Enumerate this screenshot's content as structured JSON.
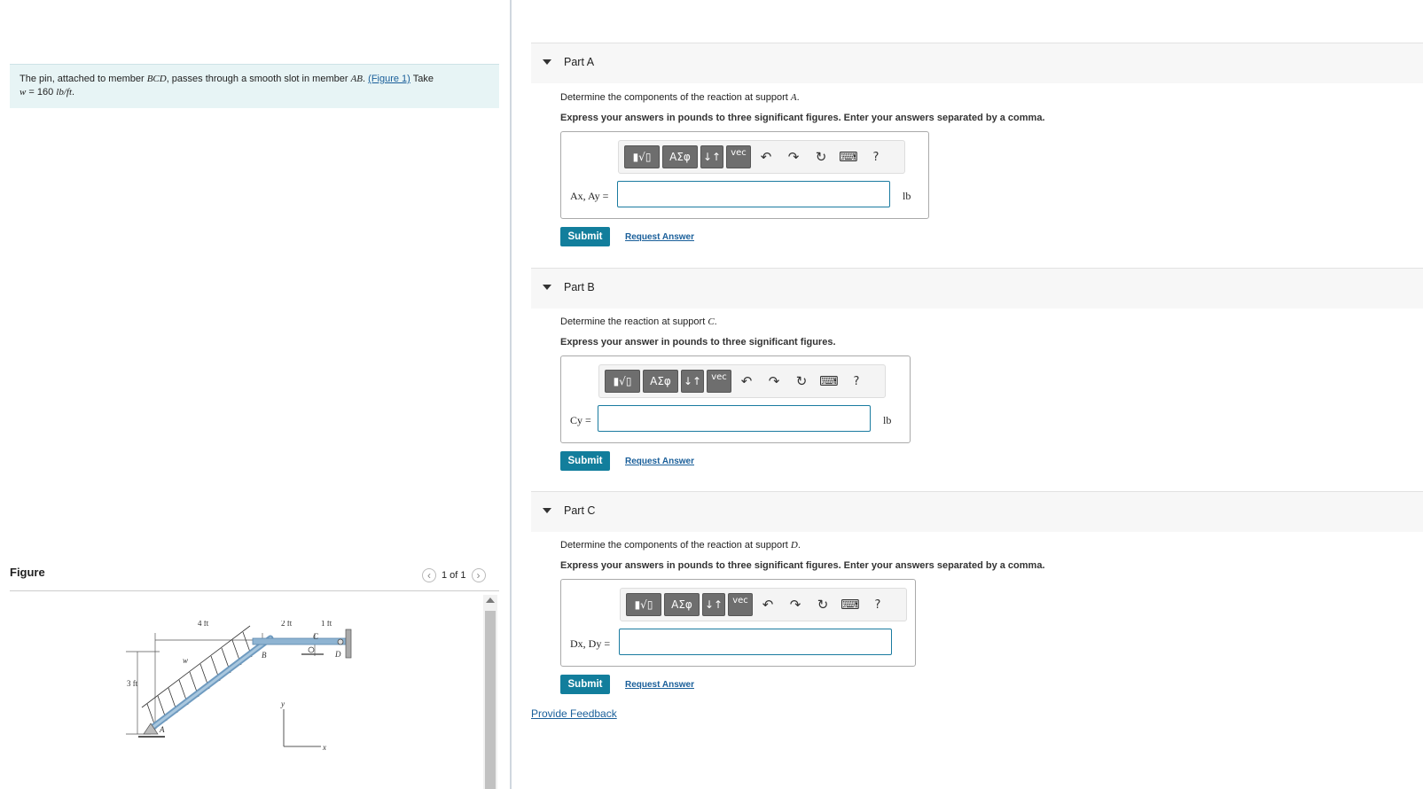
{
  "problem": {
    "text_before_bcd": "The pin, attached to member ",
    "bcd": "BCD",
    "text_mid": ", passes through a smooth slot in member ",
    "ab": "AB",
    "text_after_ab": ". ",
    "figure_link": "(Figure 1)",
    "take": " Take",
    "w_expr": "w",
    "w_value": " = 160 ",
    "w_units": "lb/ft",
    "period": "."
  },
  "figure": {
    "label": "Figure",
    "pager": "1 of 1",
    "labels": {
      "four_ft": "4 ft",
      "two_ft": "2 ft",
      "one_ft": "1 ft",
      "three_ft": "3 ft",
      "w": "w",
      "b": "B",
      "c": "C",
      "d": "D",
      "a": "A",
      "y": "y",
      "x": "x"
    }
  },
  "parts": [
    {
      "title": "Part A",
      "question_text": "Determine the components of the reaction at support ",
      "question_var": "A",
      "instruction": "Express your answers in pounds to three significant figures. Enter your answers separated by a comma.",
      "answer_label": "Ax, Ay =",
      "answer_value": "",
      "unit": "lb"
    },
    {
      "title": "Part B",
      "question_text": "Determine the reaction at support ",
      "question_var": "C",
      "instruction": "Express your answer in pounds to three significant figures.",
      "answer_label": "Cy =",
      "answer_value": "",
      "unit": "lb"
    },
    {
      "title": "Part C",
      "question_text": "Determine the components of the reaction at support ",
      "question_var": "D",
      "instruction": "Express your answers in pounds to three significant figures. Enter your answers separated by a comma.",
      "answer_label": "Dx, Dy =",
      "answer_value": "",
      "unit": "lb"
    }
  ],
  "toolbar": {
    "templates": "▮√▯",
    "greek": "ΑΣφ",
    "arrows": "↓↑",
    "vec": "vec",
    "undo_icon": "undo-icon",
    "redo_icon": "redo-icon",
    "reset_icon": "reset-icon",
    "keyboard_icon": "keyboard-icon",
    "help": "?"
  },
  "actions": {
    "submit": "Submit",
    "request_answer": "Request Answer",
    "feedback": "Provide Feedback"
  },
  "colors": {
    "accent": "#127e9c",
    "link": "#1a5f9a",
    "problem_bg": "#e7f4f5"
  }
}
